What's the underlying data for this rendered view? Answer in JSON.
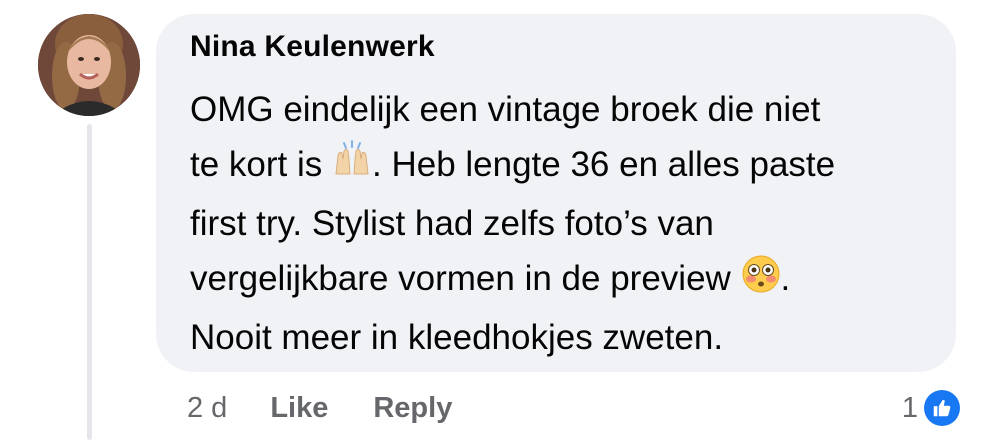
{
  "comment": {
    "author": "Nina Keulenwerk",
    "lines": [
      "OMG eindelijk een vintage broek die niet",
      "te kort is",
      ". Heb lengte 36 en alles paste",
      "first try. Stylist had zelfs foto’s van",
      "vergelijkbare vormen in de preview",
      ".",
      "Nooit meer in kleedhokjes zweten."
    ],
    "emojis": [
      "raising-hands-icon",
      "flushed-face-icon"
    ]
  },
  "actions": {
    "time": "2 d",
    "like_label": "Like",
    "reply_label": "Reply"
  },
  "reactions": {
    "count": "1",
    "icon": "like-thumb-icon",
    "color": "#1877f2"
  }
}
